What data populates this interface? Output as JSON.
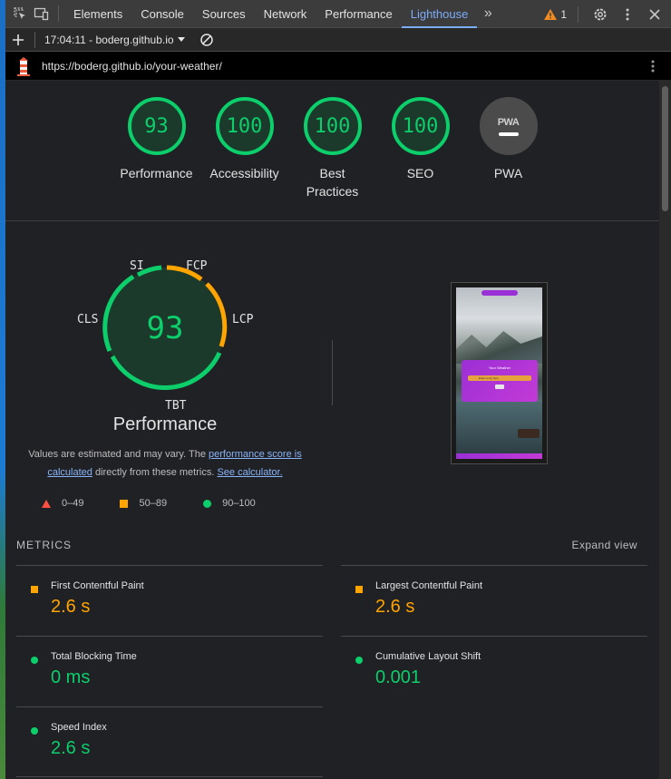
{
  "toolbar": {
    "tabs": [
      "Elements",
      "Console",
      "Sources",
      "Network",
      "Performance",
      "Lighthouse"
    ],
    "active_tab": "Lighthouse",
    "warning_count": "1"
  },
  "report_bar": {
    "timestamp_label": "17:04:11 - boderg.github.io"
  },
  "url": "https://boderg.github.io/your-weather/",
  "gauges": [
    {
      "score": "93",
      "label": "Performance"
    },
    {
      "score": "100",
      "label": "Accessibility"
    },
    {
      "score": "100",
      "label": "Best Practices"
    },
    {
      "score": "100",
      "label": "SEO"
    },
    {
      "score": "",
      "label": "PWA"
    }
  ],
  "pwa_badge": "PWA",
  "main_gauge": {
    "score": "93",
    "title": "Performance",
    "labels": {
      "si": "SI",
      "fcp": "FCP",
      "lcp": "LCP",
      "tbt": "TBT",
      "cls": "CLS"
    }
  },
  "note": {
    "text1": "Values are estimated and may vary. The ",
    "link1": "performance score is calculated",
    "text2": " directly from these metrics. ",
    "link2": "See calculator."
  },
  "legend": {
    "fail": "0–49",
    "average": "50–89",
    "pass": "90–100"
  },
  "metrics_header": "METRICS",
  "expand_view": "Expand view",
  "metrics": {
    "fcp": {
      "name": "First Contentful Paint",
      "value": "2.6 s"
    },
    "lcp": {
      "name": "Largest Contentful Paint",
      "value": "2.6 s"
    },
    "tbt": {
      "name": "Total Blocking Time",
      "value": "0 ms"
    },
    "cls": {
      "name": "Cumulative Layout Shift",
      "value": "0.001"
    },
    "si": {
      "name": "Speed Index",
      "value": "2.6 s"
    }
  },
  "screenshot": {
    "title": "Your Weather",
    "input_placeholder": "Enter a city here"
  },
  "colors": {
    "pass": "#0cce6b",
    "average": "#ffa400",
    "fail": "#ff4e42",
    "link": "#8ab4f8"
  }
}
